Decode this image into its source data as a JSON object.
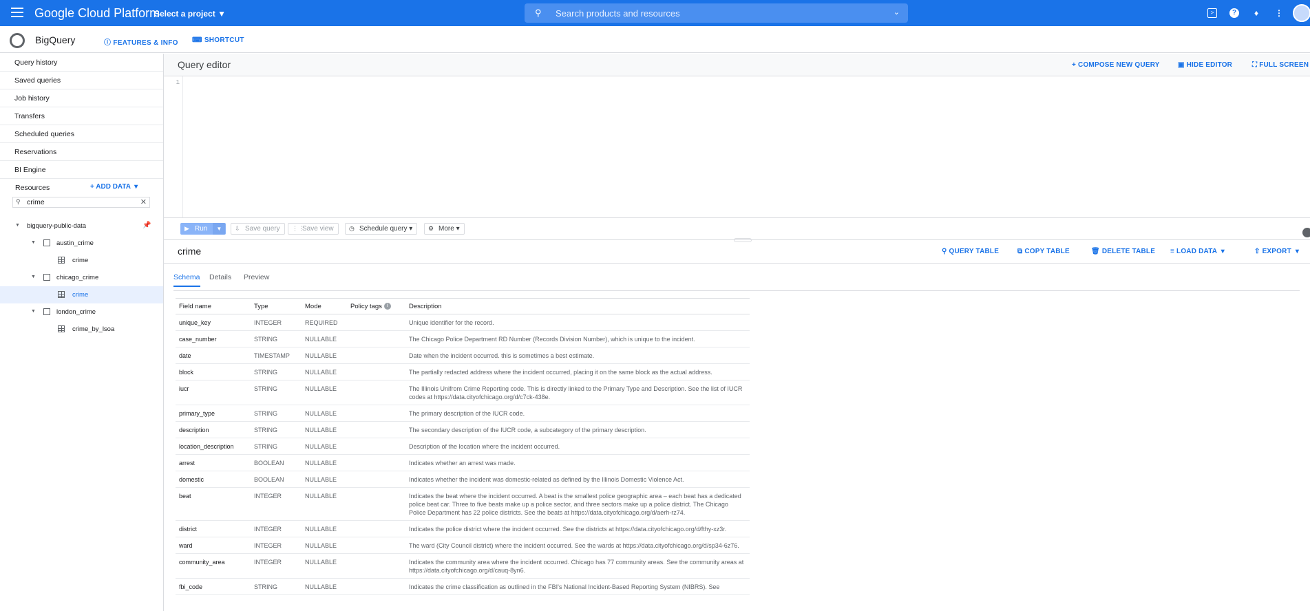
{
  "topbar": {
    "brand": "Google Cloud Platform",
    "project": "Select a project",
    "search_placeholder": "Search products and resources"
  },
  "subbar": {
    "product": "BigQuery",
    "features": "FEATURES & INFO",
    "shortcut": "SHORTCUT"
  },
  "sidebar": {
    "nav": [
      "Query history",
      "Saved queries",
      "Job history",
      "Transfers",
      "Scheduled queries",
      "Reservations",
      "BI Engine"
    ],
    "resources_label": "Resources",
    "add_data": "ADD DATA",
    "filter_value": "crime",
    "tree": {
      "project": "bigquery-public-data",
      "ds1": "austin_crime",
      "ds1_t1": "crime",
      "ds2": "chicago_crime",
      "ds2_t1": "crime",
      "ds3": "london_crime",
      "ds3_t1": "crime_by_lsoa"
    }
  },
  "editor": {
    "title": "Query editor",
    "compose": "COMPOSE NEW QUERY",
    "hide": "HIDE EDITOR",
    "full": "FULL SCREEN",
    "line1": "1"
  },
  "toolbar": {
    "run": "Run",
    "save_query": "Save query",
    "save_view": "Save view",
    "schedule": "Schedule query",
    "more": "More"
  },
  "table": {
    "name": "crime",
    "query_table": "QUERY TABLE",
    "copy_table": "COPY TABLE",
    "delete_table": "DELETE TABLE",
    "load_data": "LOAD DATA",
    "export": "EXPORT",
    "tabs": [
      "Schema",
      "Details",
      "Preview"
    ],
    "headers": [
      "Field name",
      "Type",
      "Mode",
      "Policy tags",
      "Description"
    ],
    "rows": [
      {
        "f": "unique_key",
        "t": "INTEGER",
        "m": "REQUIRED",
        "d": "Unique identifier for the record."
      },
      {
        "f": "case_number",
        "t": "STRING",
        "m": "NULLABLE",
        "d": "The Chicago Police Department RD Number (Records Division Number), which is unique to the incident."
      },
      {
        "f": "date",
        "t": "TIMESTAMP",
        "m": "NULLABLE",
        "d": "Date when the incident occurred. this is sometimes a best estimate."
      },
      {
        "f": "block",
        "t": "STRING",
        "m": "NULLABLE",
        "d": "The partially redacted address where the incident occurred, placing it on the same block as the actual address."
      },
      {
        "f": "iucr",
        "t": "STRING",
        "m": "NULLABLE",
        "d": "The Illinois Unifrom Crime Reporting code. This is directly linked to the Primary Type and Description. See the list of IUCR codes at https://data.cityofchicago.org/d/c7ck-438e."
      },
      {
        "f": "primary_type",
        "t": "STRING",
        "m": "NULLABLE",
        "d": "The primary description of the IUCR code."
      },
      {
        "f": "description",
        "t": "STRING",
        "m": "NULLABLE",
        "d": "The secondary description of the IUCR code, a subcategory of the primary description."
      },
      {
        "f": "location_description",
        "t": "STRING",
        "m": "NULLABLE",
        "d": "Description of the location where the incident occurred."
      },
      {
        "f": "arrest",
        "t": "BOOLEAN",
        "m": "NULLABLE",
        "d": "Indicates whether an arrest was made."
      },
      {
        "f": "domestic",
        "t": "BOOLEAN",
        "m": "NULLABLE",
        "d": "Indicates whether the incident was domestic-related as defined by the Illinois Domestic Violence Act."
      },
      {
        "f": "beat",
        "t": "INTEGER",
        "m": "NULLABLE",
        "d": "Indicates the beat where the incident occurred. A beat is the smallest police geographic area – each beat has a dedicated police beat car. Three to five beats make up a police sector, and three sectors make up a police district. The Chicago Police Department has 22 police districts. See the beats at https://data.cityofchicago.org/d/aerh-rz74."
      },
      {
        "f": "district",
        "t": "INTEGER",
        "m": "NULLABLE",
        "d": "Indicates the police district where the incident occurred. See the districts at https://data.cityofchicago.org/d/fthy-xz3r."
      },
      {
        "f": "ward",
        "t": "INTEGER",
        "m": "NULLABLE",
        "d": "The ward (City Council district) where the incident occurred. See the wards at https://data.cityofchicago.org/d/sp34-6z76."
      },
      {
        "f": "community_area",
        "t": "INTEGER",
        "m": "NULLABLE",
        "d": "Indicates the community area where the incident occurred. Chicago has 77 community areas. See the community areas at https://data.cityofchicago.org/d/cauq-8yn6."
      },
      {
        "f": "fbi_code",
        "t": "STRING",
        "m": "NULLABLE",
        "d": "Indicates the crime classification as outlined in the FBI's National Incident-Based Reporting System (NIBRS). See"
      }
    ]
  }
}
